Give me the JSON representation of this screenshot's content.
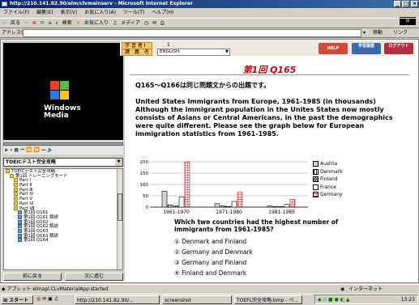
{
  "window": {
    "title": "http://210.141.82.90/elm/clvmainserv - Microsoft Internet Explorer",
    "controls": [
      "_",
      "□",
      "×"
    ]
  },
  "menu": [
    "ファイル(F)",
    "編集(E)",
    "表示(V)",
    "お気に入り(A)",
    "ツール(T)",
    "ヘルプ(H)"
  ],
  "toolbar": {
    "back": "戻る",
    "search": "検索",
    "favorites": "お気に入り",
    "media": "メディア"
  },
  "address": {
    "label": "アドレス(D)",
    "value": "",
    "go": "移動",
    "links": "リンク"
  },
  "player": {
    "logo_text": "Windows Media",
    "controls_text": "▶ ⏸ ■  ⏮ ⏪ ⏩ ⏭  🔈"
  },
  "course_select": "TOEICテスト完全攻略",
  "tree": [
    {
      "label": "TOEICテスト完全攻略",
      "indent": 0,
      "type": "folder"
    },
    {
      "label": "第1回 トレーニングモード",
      "indent": 1,
      "type": "folder"
    },
    {
      "label": "Part Ⅰ",
      "indent": 2,
      "type": "folder"
    },
    {
      "label": "Part Ⅱ",
      "indent": 2,
      "type": "folder"
    },
    {
      "label": "Part Ⅲ",
      "indent": 2,
      "type": "folder"
    },
    {
      "label": "Part Ⅳ",
      "indent": 2,
      "type": "folder"
    },
    {
      "label": "Part Ⅴ",
      "indent": 2,
      "type": "folder"
    },
    {
      "label": "Part Ⅵ",
      "indent": 2,
      "type": "folder"
    },
    {
      "label": "Part Ⅶ",
      "indent": 2,
      "type": "folder"
    },
    {
      "label": "第1回 Q161",
      "indent": 3,
      "type": "doc"
    },
    {
      "label": "第1回 Q161 解説",
      "indent": 3,
      "type": "doc"
    },
    {
      "label": "第1回 Q162",
      "indent": 3,
      "type": "doc"
    },
    {
      "label": "第1回 Q162 解説",
      "indent": 3,
      "type": "doc"
    },
    {
      "label": "第1回 Q163",
      "indent": 3,
      "type": "doc"
    },
    {
      "label": "第1回 Q163 解説",
      "indent": 3,
      "type": "doc"
    },
    {
      "label": "第1回 Q164",
      "indent": 3,
      "type": "doc"
    }
  ],
  "nav": {
    "prev": "前に戻る",
    "next": "次に進む"
  },
  "header": {
    "student_id_label": "学 習 者 I D",
    "student_id_value": "1",
    "course_label": "講　義　名",
    "course_value": "ENGLISH",
    "help": "HELP",
    "history": "学習履歴",
    "logout": "ログアウト"
  },
  "question": {
    "title": "第1回 Q165",
    "intro": "Q165〜Q166は同じ問題文からの出題です。",
    "passage_title": "United States Immigrants from Europe, 1961-1985 (in thousands)",
    "passage_body": "Although the immigrant population in the Unites States now mostly consists of Asians or Central Americans, in the past the demographics were quite different. Please see the graph below for European immigration statistics from 1961-1985.",
    "prompt": "Which two countries had the highest number of immigrants from 1961-1985?",
    "options": [
      "① Denmark and Finland",
      "② Germany and Denmark",
      "③ Germany and Finland",
      "④ Finland and Denmark"
    ]
  },
  "chart_data": {
    "type": "bar",
    "categories": [
      "1961-1970",
      "1971-1980",
      "1981-1985"
    ],
    "series": [
      {
        "name": "Austria",
        "values": [
          70,
          15,
          5
        ],
        "color": "#d4d4d4",
        "pattern": "solid"
      },
      {
        "name": "Denmark",
        "values": [
          10,
          5,
          3
        ],
        "color": "#ffffff",
        "pattern": "stripes"
      },
      {
        "name": "Finland",
        "values": [
          5,
          3,
          2
        ],
        "color": "#808080",
        "pattern": "checker"
      },
      {
        "name": "France",
        "values": [
          45,
          25,
          12
        ],
        "color": "#ffffff",
        "pattern": "solid"
      },
      {
        "name": "Germany",
        "values": [
          200,
          65,
          35
        ],
        "color": "#ffffff",
        "pattern": "redgrid"
      }
    ],
    "ylim": [
      0,
      200
    ],
    "yticks": [
      0,
      50,
      100,
      150,
      200
    ],
    "grid": true,
    "legend": "right"
  },
  "status": {
    "text": "アプレット elmapl.CLvMaterialApp started",
    "zone": "インターネット"
  },
  "taskbar": {
    "start": "スタート",
    "items": [
      "http://210.141.82.90/...",
      "screenshot",
      "TOEFL完全攻略.bmp - ペ..."
    ],
    "clock": "13:23"
  }
}
